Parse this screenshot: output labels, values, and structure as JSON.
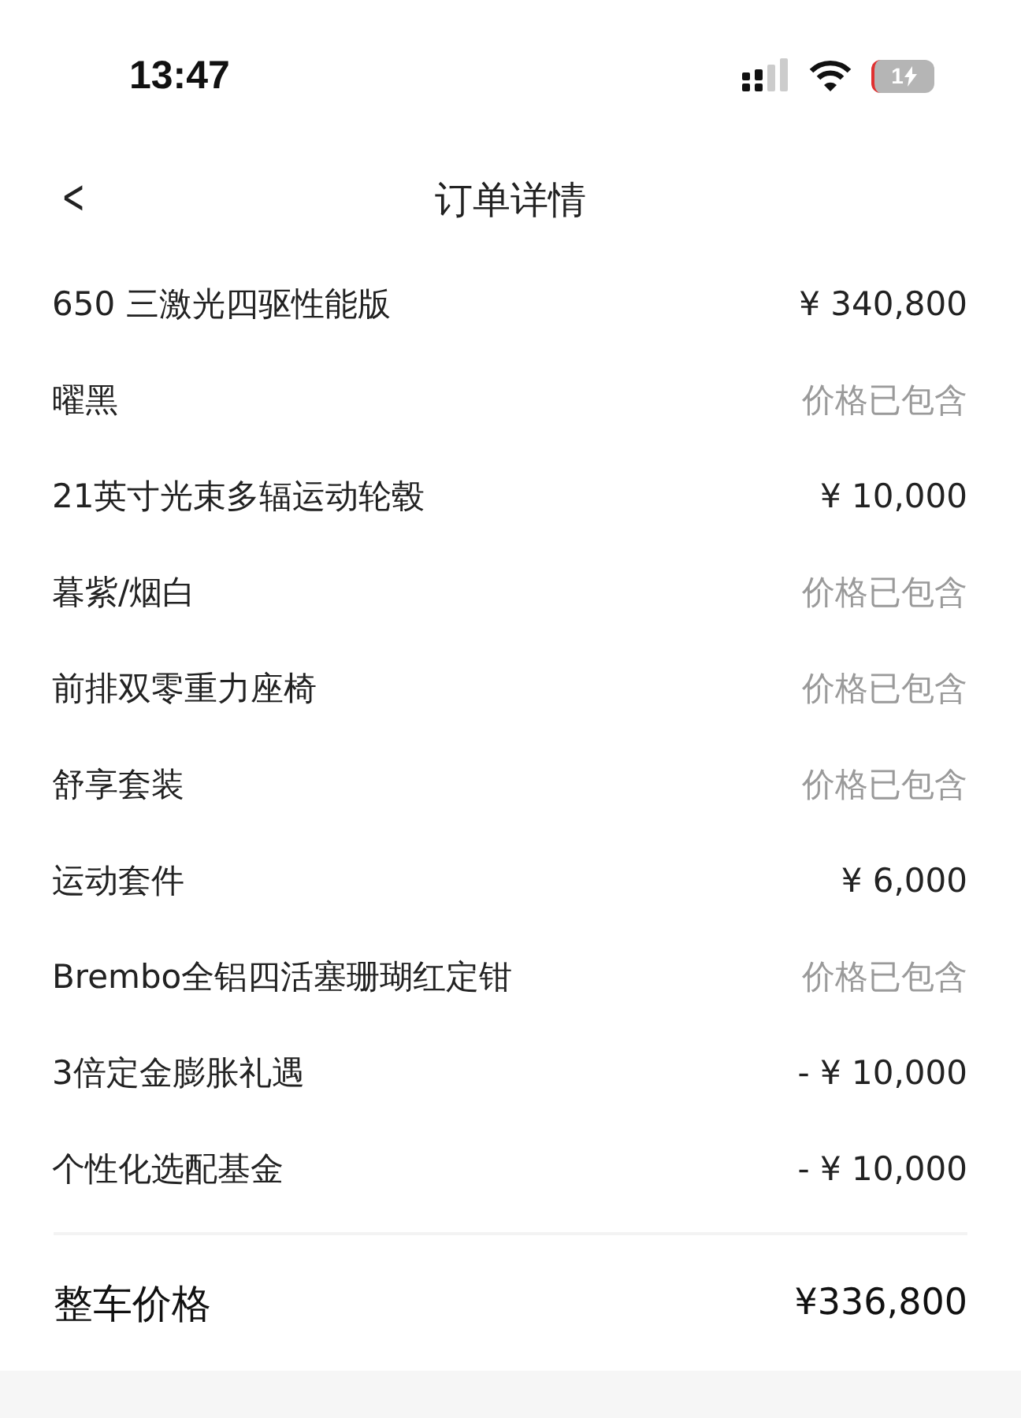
{
  "status_bar": {
    "time": "13:47",
    "battery_text": "1"
  },
  "nav": {
    "back": "<",
    "title": "订单详情"
  },
  "items": [
    {
      "name": "650 三激光四驱性能版",
      "value": "¥ 340,800",
      "kind": "price"
    },
    {
      "name": "曜黑",
      "value": "价格已包含",
      "kind": "included"
    },
    {
      "name": "21英寸光束多辐运动轮毂",
      "value": "¥ 10,000",
      "kind": "price"
    },
    {
      "name": "暮紫/烟白",
      "value": "价格已包含",
      "kind": "included"
    },
    {
      "name": "前排双零重力座椅",
      "value": "价格已包含",
      "kind": "included"
    },
    {
      "name": "舒享套装",
      "value": "价格已包含",
      "kind": "included"
    },
    {
      "name": "运动套件",
      "value": "¥ 6,000",
      "kind": "price"
    },
    {
      "name": "Brembo全铝四活塞珊瑚红定钳",
      "value": "价格已包含",
      "kind": "included"
    },
    {
      "name": "3倍定金膨胀礼遇",
      "value": "- ¥ 10,000",
      "kind": "price"
    },
    {
      "name": "个性化选配基金",
      "value": "- ¥ 10,000",
      "kind": "price"
    }
  ],
  "total": {
    "label": "整车价格",
    "value": "¥336,800"
  }
}
